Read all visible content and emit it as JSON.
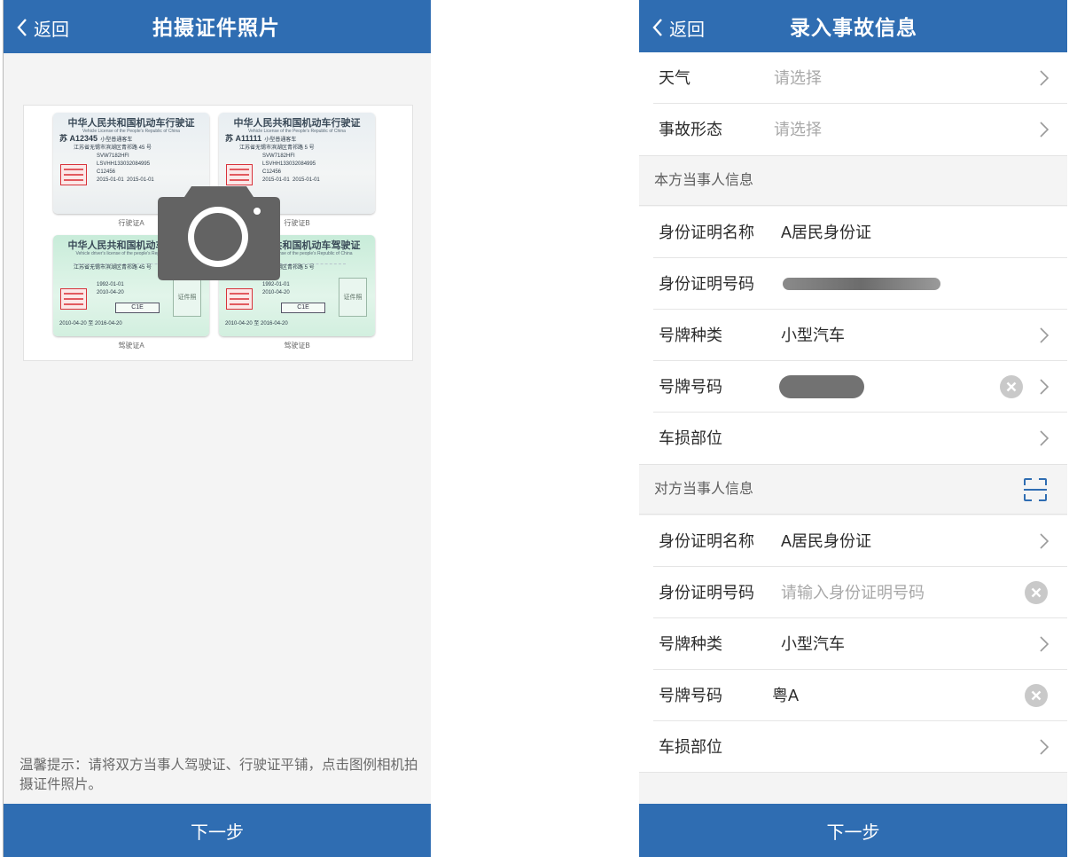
{
  "left_screen": {
    "back_label": "返回",
    "title": "拍摄证件照片",
    "samples": [
      {
        "title": "中华人民共和国机动车行驶证",
        "subtitle": "Vehicle License of the People's Republic of China",
        "plate": "苏 A12345",
        "vehicle_type": "小型普通客车",
        "address": "江苏省无锡市滨湖区青祁路 45 号",
        "model": "SVW7182HFI",
        "vin": "LSVHH133032084995",
        "engine": "C12456",
        "register_date": "2015-01-01",
        "issue_date": "2015-01-01",
        "caption": "行驶证A"
      },
      {
        "title": "中华人民共和国机动车行驶证",
        "subtitle": "Vehicle License of the People's Republic of China",
        "plate": "苏 A11111",
        "vehicle_type": "小型普通客车",
        "address": "江苏省无锡市滨湖区青祁路 5 号",
        "model": "SVW7182HFI",
        "vin": "LSVHH133032084995",
        "engine": "C12456",
        "register_date": "2015-01-01",
        "issue_date": "2015-01-01",
        "caption": "行驶证B"
      },
      {
        "title": "中华人民共和国机动车驾驶证",
        "subtitle": "Vehicle driver's license of the people's Republic of China",
        "address": "江苏省无锡市滨湖区青祁路 45 号",
        "birth": "1992-01-01",
        "first_issue": "2010-04-20",
        "class": "C1E",
        "valid": "2010-04-20 至 2016-04-20",
        "photo": "证件照",
        "caption": "驾驶证A"
      },
      {
        "title": "中华人民共和国机动车驾驶证",
        "subtitle": "Vehicle driver's license of the people's Republic of China",
        "address": "江苏省无锡市滨湖区青祁路 5 号",
        "birth": "1992-01-01",
        "first_issue": "2010-04-20",
        "class": "C1E",
        "valid": "2010-04-20 至 2016-04-20",
        "photo": "证件照",
        "caption": "驾驶证B"
      }
    ],
    "tip": "温馨提示：请将双方当事人驾驶证、行驶证平铺，点击图例相机拍摄证件照片。",
    "next_label": "下一步"
  },
  "right_screen": {
    "back_label": "返回",
    "title": "录入事故信息",
    "weather": {
      "label": "天气",
      "placeholder": "请选择"
    },
    "accident_form": {
      "label": "事故形态",
      "placeholder": "请选择"
    },
    "own_section": "本方当事人信息",
    "own": {
      "id_name_label": "身份证明名称",
      "id_name_value": "A居民身份证",
      "id_number_label": "身份证明号码",
      "plate_type_label": "号牌种类",
      "plate_type_value": "小型汽车",
      "plate_number_label": "号牌号码",
      "damage_label": "车损部位"
    },
    "other_section": "对方当事人信息",
    "other": {
      "id_name_label": "身份证明名称",
      "id_name_value": "A居民身份证",
      "id_number_label": "身份证明号码",
      "id_number_placeholder": "请输入身份证明号码",
      "plate_type_label": "号牌种类",
      "plate_type_value": "小型汽车",
      "plate_number_label": "号牌号码",
      "plate_number_value": "粤A",
      "damage_label": "车损部位"
    },
    "next_label": "下一步"
  },
  "colors": {
    "brand_blue": "#2f6db2",
    "background": "#f4f4f4",
    "placeholder": "#a8a8a8"
  },
  "icons": [
    "chevron-left-icon",
    "camera-icon",
    "chevron-right-icon",
    "clear-icon",
    "scan-icon"
  ]
}
